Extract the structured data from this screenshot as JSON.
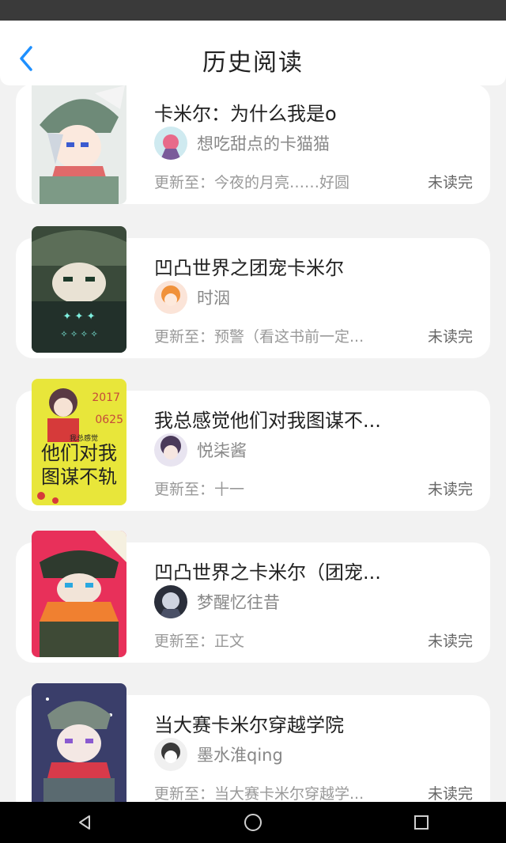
{
  "header": {
    "title": "历史阅读",
    "back_icon": "chevron-left-icon",
    "accent": "#1e90ff"
  },
  "books": [
    {
      "title": "卡米尔：为什么我是o",
      "author": "想吃甜点的卡猫猫",
      "update_prefix": "更新至：",
      "update_chapter": "今夜的月亮……好圆",
      "status": "未读完"
    },
    {
      "title": "凹凸世界之团宠卡米尔",
      "author": "时洇",
      "update_prefix": "更新至：",
      "update_chapter": "预警（看这书前一定...",
      "status": "未读完"
    },
    {
      "title": "我总感觉他们对我图谋不...",
      "author": "悦柒酱",
      "update_prefix": "更新至：",
      "update_chapter": "十一",
      "status": "未读完",
      "cover_text": {
        "year": "2017",
        "date": "0625",
        "small": "我总感觉",
        "line1": "他们对我",
        "line2": "图谋不轨"
      }
    },
    {
      "title": "凹凸世界之卡米尔（团宠...",
      "author": "梦醒忆往昔",
      "update_prefix": "更新至：",
      "update_chapter": "正文",
      "status": "未读完"
    },
    {
      "title": "当大赛卡米尔穿越学院",
      "author": "墨水淮qing",
      "update_prefix": "更新至：",
      "update_chapter": "当大赛卡米尔穿越学...",
      "status": "未读完"
    }
  ],
  "nav": {
    "back_icon": "triangle-back-icon",
    "home_icon": "circle-home-icon",
    "recents_icon": "square-recents-icon"
  }
}
